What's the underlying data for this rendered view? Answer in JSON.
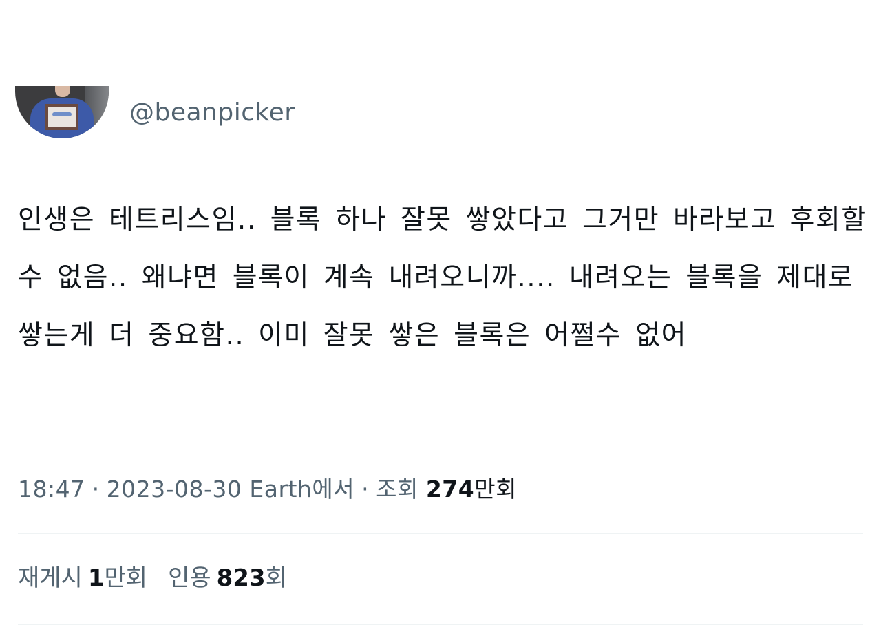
{
  "author": {
    "handle": "@beanpicker"
  },
  "tweet": {
    "text": "인생은 테트리스임.. 블록 하나 잘못 쌓았다고 그거만 바라보고 후회할 수 없음.. 왜냐면 블록이 계속 내려오니까.... 내려오는 블록을 제대로 쌓는게 더 중요함.. 이미 잘못 쌓은 블록은 어쩔수 없어"
  },
  "meta": {
    "time": "18:47",
    "separator": "·",
    "date": "2023-08-30",
    "source": "Earth에서",
    "views_label": "조회",
    "views_value": "274",
    "views_unit": "만회"
  },
  "stats": {
    "retweets_label": "재게시",
    "retweets_value": "1",
    "retweets_unit": "만회",
    "quotes_label": "인용",
    "quotes_value": "823",
    "quotes_unit": "회"
  },
  "colors": {
    "text": "#0f1419",
    "secondary": "#536471",
    "divider": "#eff3f4"
  }
}
